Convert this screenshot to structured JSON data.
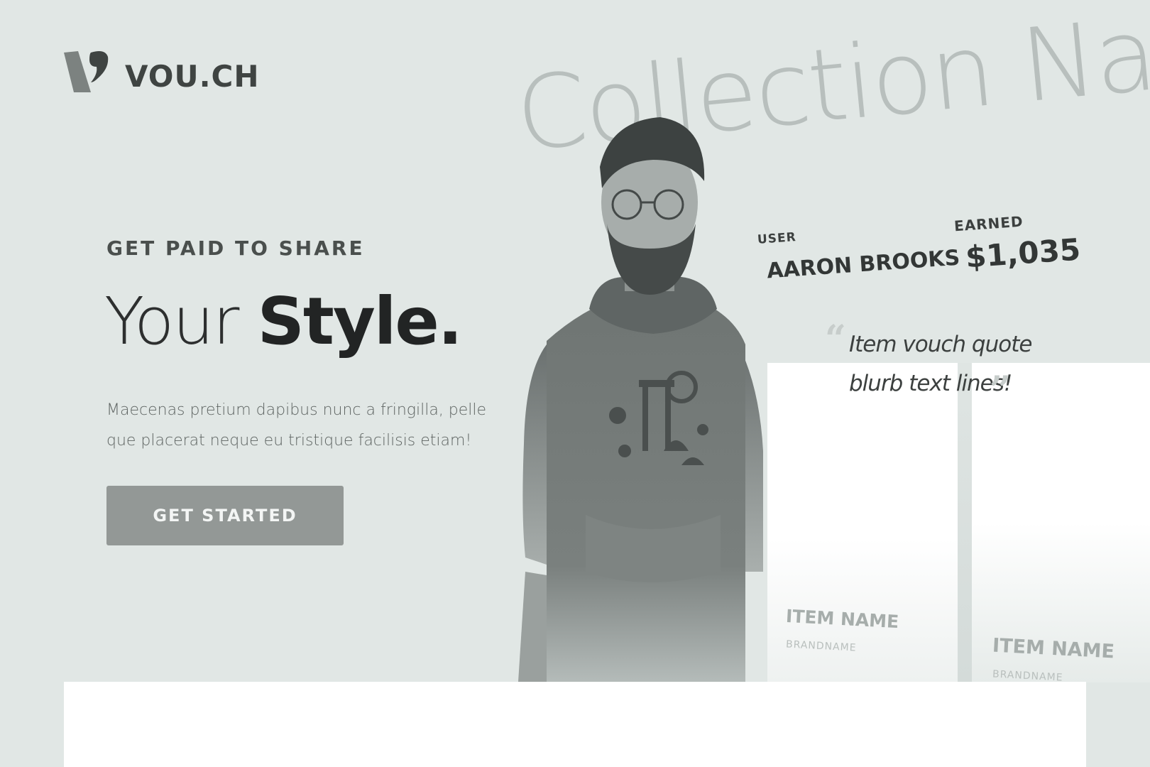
{
  "brand": {
    "name": "VOU.CH"
  },
  "hero": {
    "eyebrow": "GET PAID TO SHARE",
    "headline_light": "Your ",
    "headline_bold": "Style.",
    "body": "Maecenas pretium dapibus nunc a fringilla, pelle que placerat neque eu tristique facilisis etiam!",
    "cta_label": "GET STARTED"
  },
  "showcase": {
    "collection_name": "Collection Name",
    "user_label": "USER",
    "user_name": "AARON BROOKS",
    "earned_label": "EARNED",
    "earned_value": "$1,035",
    "quote": "Item vouch quote blurb text lines!",
    "items": [
      {
        "name": "ITEM NAME",
        "brand": "BRANDNAME"
      },
      {
        "name": "ITEM NAME",
        "brand": "BRANDNAME"
      }
    ]
  },
  "colors": {
    "background": "#e1e7e5",
    "cta": "#939896",
    "text_dark": "#262828"
  }
}
